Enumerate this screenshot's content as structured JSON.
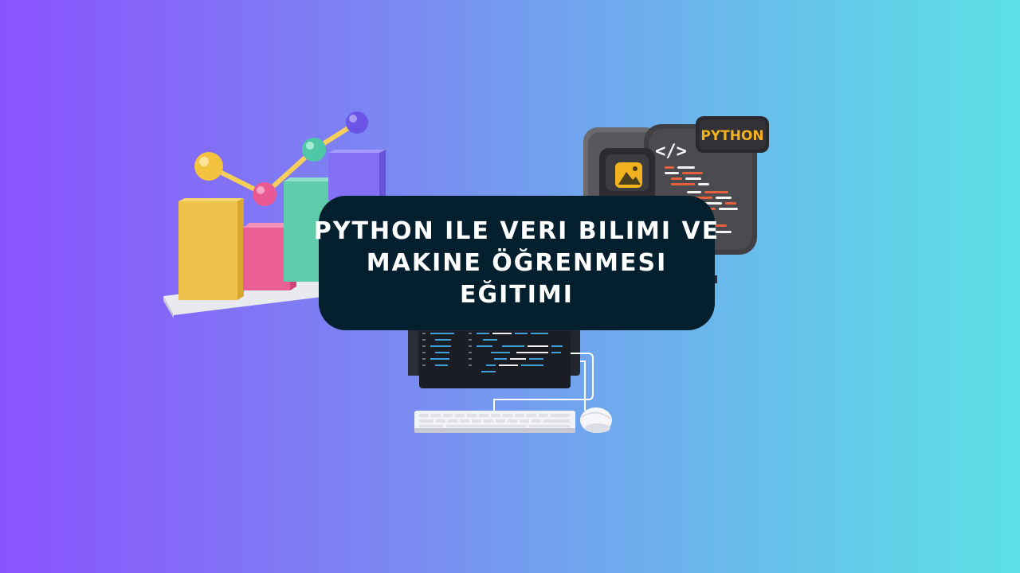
{
  "title": {
    "lines": [
      "PYTHON ILE VERI BILIMI VE",
      "MAKINE ÖĞRENMESI",
      "EĞITIMI"
    ]
  },
  "badge": {
    "label": "PYTHON",
    "code_symbol": "</>"
  },
  "colors": {
    "gradient_start": "#8a52fe",
    "gradient_end": "#5ce1e6",
    "title_box": "#04202f",
    "title_text": "#ffffff",
    "badge_text": "#f2b11e"
  },
  "icons": [
    "bar-chart-3d",
    "python-code-window",
    "desktop-computer",
    "keyboard",
    "mouse"
  ]
}
